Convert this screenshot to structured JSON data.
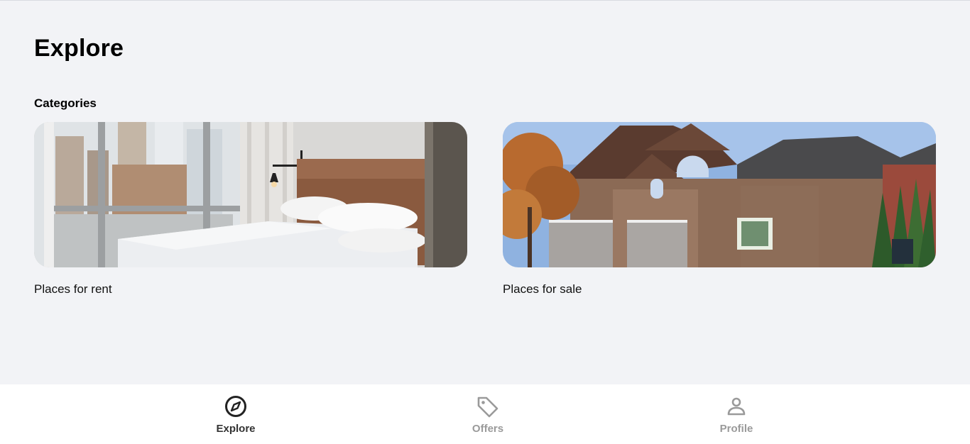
{
  "page": {
    "title": "Explore",
    "section_label": "Categories"
  },
  "categories": [
    {
      "label": "Places for rent",
      "image": "bedroom-photo"
    },
    {
      "label": "Places for sale",
      "image": "house-photo"
    }
  ],
  "bottom_nav": {
    "items": [
      {
        "label": "Explore",
        "icon": "compass-icon",
        "active": true
      },
      {
        "label": "Offers",
        "icon": "tag-icon",
        "active": false
      },
      {
        "label": "Profile",
        "icon": "person-icon",
        "active": false
      }
    ]
  },
  "colors": {
    "background": "#f2f3f6",
    "nav_background": "#ffffff",
    "active_nav": "#333333",
    "inactive_nav": "#9a9a9a"
  }
}
